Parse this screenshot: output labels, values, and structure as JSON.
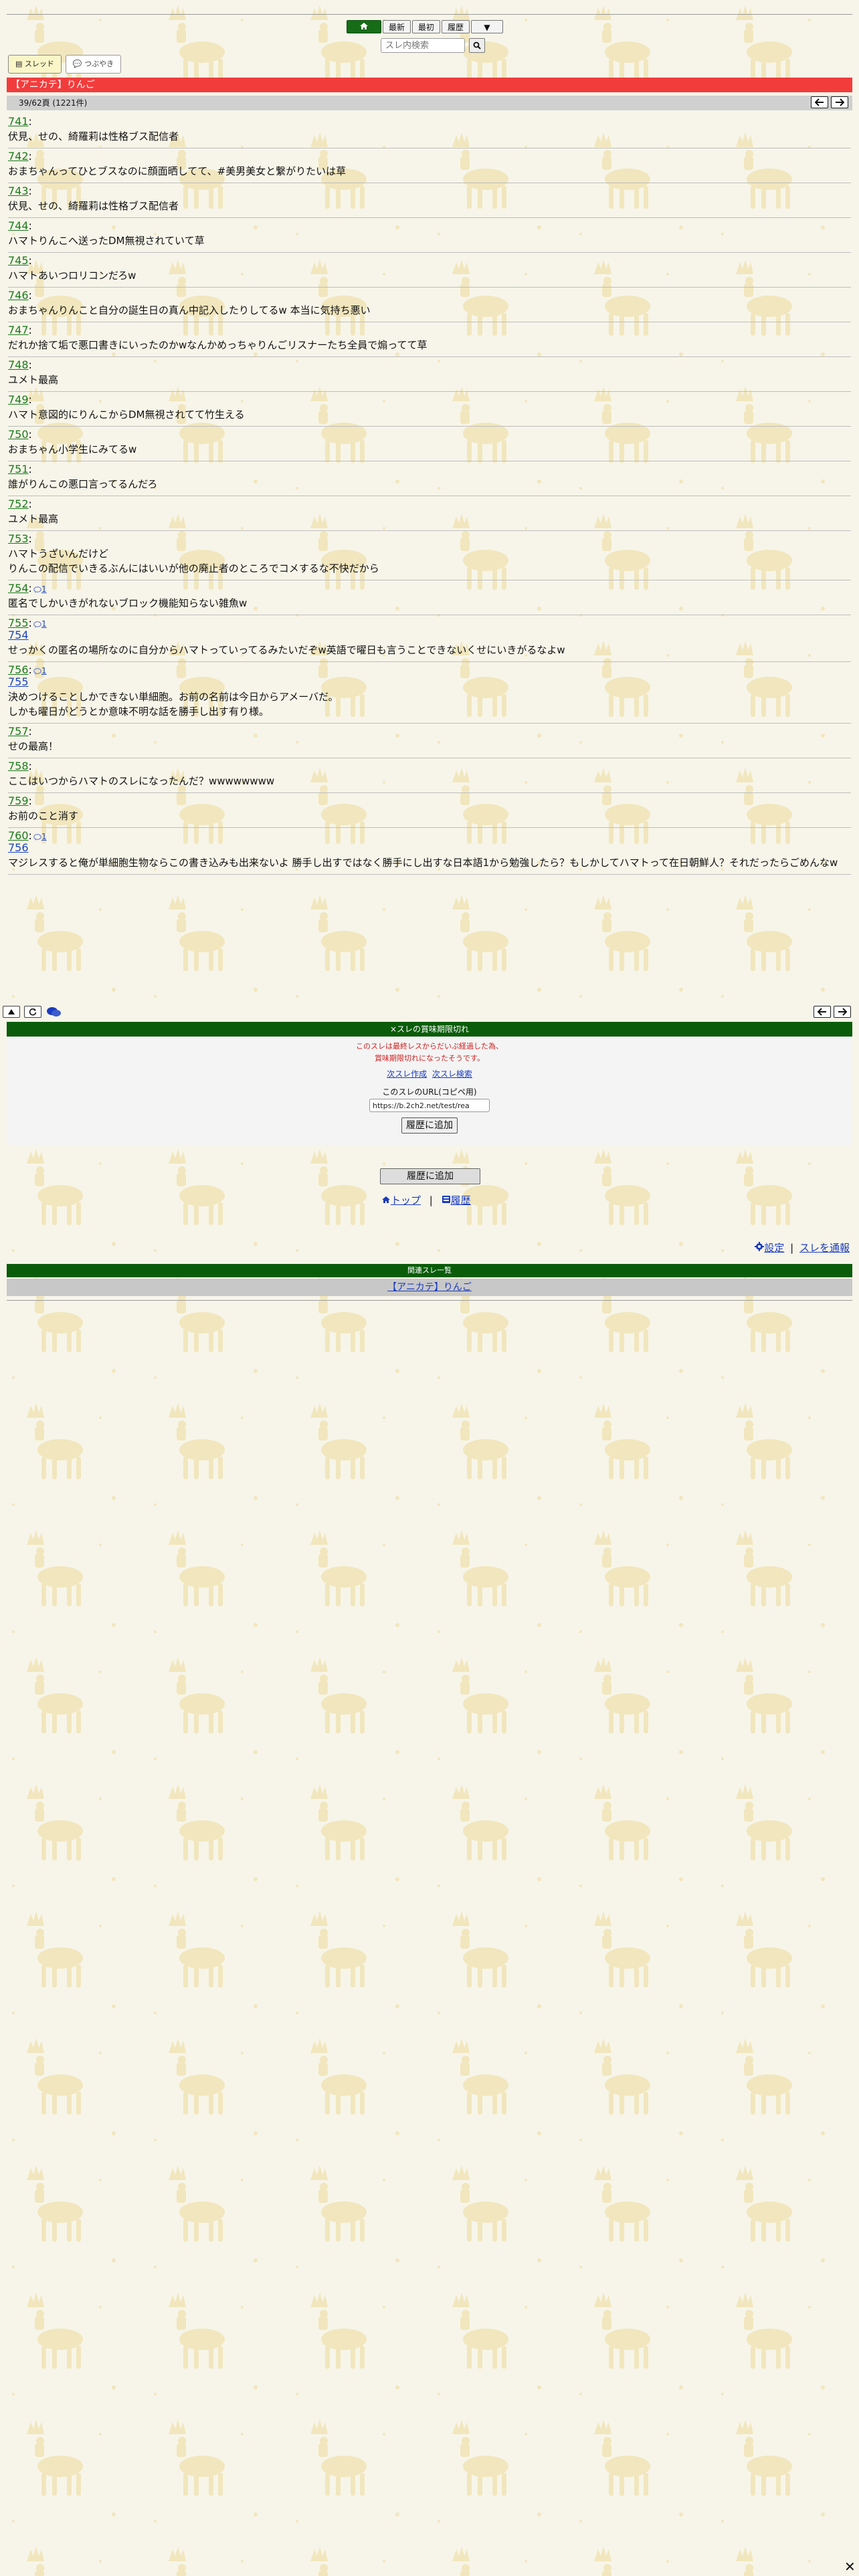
{
  "nav": {
    "home_icon": "home-icon",
    "latest": "最新",
    "first": "最初",
    "history": "履歴",
    "dropdown": "▼",
    "search_placeholder": "スレ内検索"
  },
  "tabs": {
    "thread": "スレッド",
    "tsubuyaki": "つぶやき"
  },
  "thread_title": "【アニカテ】りんご",
  "page_info": "39/62頁 (1221件)",
  "posts": [
    {
      "num": "741",
      "lines": [
        "伏見、せの、綺羅莉は性格ブス配信者"
      ]
    },
    {
      "num": "742",
      "lines": [
        "おまちゃんってひとブスなのに顔面晒してて、#美男美女と繋がりたいは草"
      ]
    },
    {
      "num": "743",
      "lines": [
        "伏見、せの、綺羅莉は性格ブス配信者"
      ]
    },
    {
      "num": "744",
      "lines": [
        "ハマトりんこへ送ったDM無視されていて草"
      ]
    },
    {
      "num": "745",
      "lines": [
        "ハマトあいつロリコンだろw"
      ]
    },
    {
      "num": "746",
      "lines": [
        "おまちゃんりんこと自分の誕生日の真ん中記入したりしてるw 本当に気持ち悪い"
      ]
    },
    {
      "num": "747",
      "lines": [
        "だれか捨て垢で悪口書きにいったのかwなんかめっちゃりんごリスナーたち全員で煽ってて草"
      ]
    },
    {
      "num": "748",
      "lines": [
        "ユメト最高"
      ]
    },
    {
      "num": "749",
      "lines": [
        "ハマト意図的にりんこからDM無視されてて竹生える"
      ]
    },
    {
      "num": "750",
      "lines": [
        "おまちゃん小学生にみてるw"
      ]
    },
    {
      "num": "751",
      "lines": [
        "誰がりんこの悪口言ってるんだろ"
      ]
    },
    {
      "num": "752",
      "lines": [
        "ユメト最高"
      ]
    },
    {
      "num": "753",
      "lines": [
        "ハマトうざいんだけど",
        "りんこの配信でいきるぶんにはいいが他の廃止者のところでコメするな不快だから"
      ]
    },
    {
      "num": "754",
      "reply_count": "1",
      "lines": [
        "匿名でしかいきがれないブロック機能知らない雑魚w"
      ]
    },
    {
      "num": "755",
      "reply_count": "1",
      "anchor": "754",
      "lines": [
        "せっかくの匿名の場所なのに自分からハマトっていってるみたいだぞw英語で曜日も言うことできないくせにいきがるなよw"
      ]
    },
    {
      "num": "756",
      "reply_count": "1",
      "anchor": "755",
      "lines": [
        "決めつけることしかできない単細胞。お前の名前は今日からアメーバだ。",
        "しかも曜日がどうとか意味不明な話を勝手し出す有り様。"
      ]
    },
    {
      "num": "757",
      "lines": [
        "せの最高！"
      ]
    },
    {
      "num": "758",
      "lines": [
        "ここはいつからハマトのスレになったんだ？wwwwwwww"
      ]
    },
    {
      "num": "759",
      "lines": [
        "お前のこと消す"
      ]
    },
    {
      "num": "760",
      "reply_count": "1",
      "anchor": "756",
      "lines": [
        "マジレスすると俺が単細胞生物ならこの書き込みも出来ないよ 勝手し出すではなく勝手にし出すな日本語1から勉強したら？もしかしてハマトって在日朝鮮人？それだったらごめんなw"
      ]
    }
  ],
  "expired": {
    "header": "×スレの賞味期限切れ",
    "msg1": "このスレは最終レスからだいぶ経過した為、",
    "msg2": "賞味期限切れになったそうです。",
    "link_create": "次スレ作成",
    "link_search": "次スレ検索",
    "url_label": "このスレのURL(コピペ用)",
    "url_value": "https://b.2ch2.net/test/rea",
    "add_history": "履歴に追加"
  },
  "footer": {
    "add_history": "履歴に追加",
    "top": "トップ",
    "sep": "|",
    "history": "履歴",
    "settings": "設定",
    "report": "スレを通報"
  },
  "related": {
    "header": "関連スレ一覧",
    "item": "【アニカテ】りんご"
  },
  "close": "✕",
  "colors": {
    "title_bar": "#f23c3c",
    "green_header": "#0a5c0a",
    "link": "#1a3bbf",
    "post_num": "#1a7a1a"
  }
}
